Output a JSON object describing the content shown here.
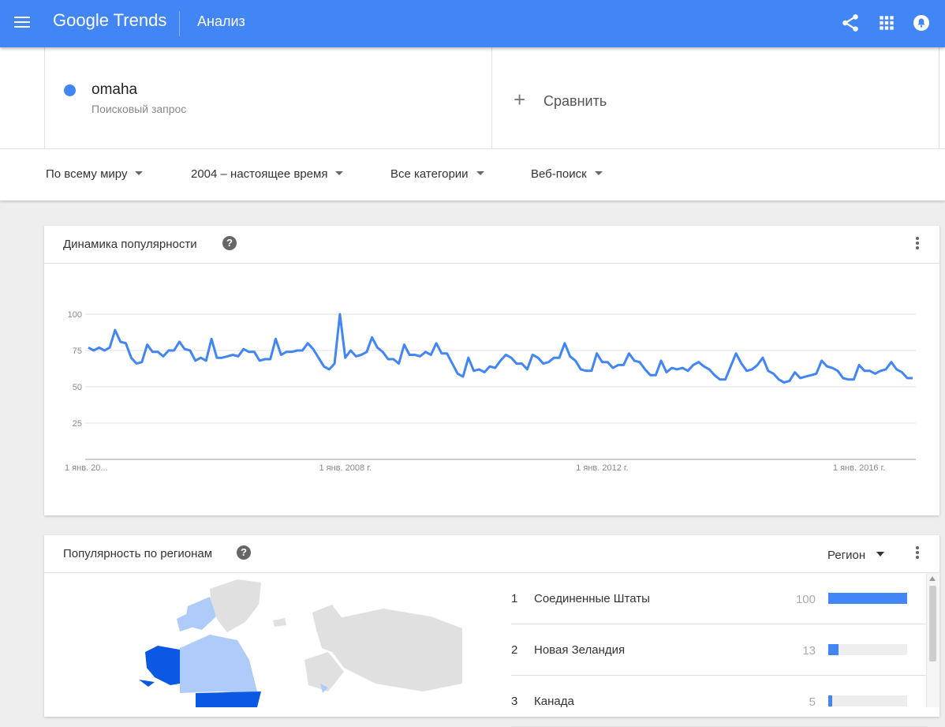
{
  "header": {
    "logo_google": "Google",
    "logo_trends": "Trends",
    "page_title": "Анализ",
    "bg_color": "#4285f4"
  },
  "search": {
    "term": "omaha",
    "term_type": "Поисковый запрос",
    "term_color": "#4285f4",
    "compare_label": "Сравнить"
  },
  "filters": {
    "location": "По всему миру",
    "time_range": "2004 – настоящее время",
    "category": "Все категории",
    "search_type": "Веб-поиск"
  },
  "interest_over_time": {
    "title": "Динамика популярности",
    "help": "?"
  },
  "chart_data": {
    "type": "line",
    "series": [
      {
        "name": "omaha",
        "start": "2004-01",
        "frequency": "monthly",
        "color": "#4285f4",
        "values": [
          77,
          75,
          77,
          75,
          77,
          89,
          81,
          80,
          70,
          66,
          67,
          79,
          74,
          74,
          71,
          75,
          75,
          81,
          76,
          75,
          68,
          70,
          68,
          83,
          70,
          70,
          71,
          72,
          71,
          76,
          74,
          74,
          68,
          69,
          69,
          83,
          72,
          74,
          74,
          75,
          75,
          80,
          76,
          70,
          64,
          62,
          66,
          100,
          70,
          75,
          71,
          72,
          74,
          84,
          77,
          74,
          69,
          69,
          66,
          79,
          72,
          72,
          71,
          74,
          72,
          80,
          73,
          73,
          66,
          59,
          57,
          70,
          61,
          62,
          60,
          64,
          63,
          68,
          72,
          70,
          66,
          66,
          62,
          72,
          70,
          66,
          67,
          70,
          70,
          80,
          71,
          68,
          62,
          61,
          61,
          73,
          67,
          67,
          63,
          65,
          65,
          73,
          68,
          67,
          62,
          58,
          58,
          68,
          60,
          63,
          62,
          63,
          61,
          65,
          67,
          64,
          62,
          58,
          55,
          55,
          64,
          73,
          66,
          61,
          62,
          65,
          70,
          61,
          59,
          55,
          53,
          54,
          60,
          56,
          57,
          58,
          59,
          68,
          64,
          63,
          61,
          56,
          55,
          55,
          65,
          61,
          61,
          59,
          61,
          62,
          67,
          62,
          60,
          56,
          56
        ]
      }
    ],
    "x_ticks": [
      "1 янв. 20...",
      "1 янв. 2008 г.",
      "1 янв. 2012 г.",
      "1 янв. 2016 г."
    ],
    "y_ticks": [
      100,
      75,
      50,
      25
    ],
    "ylim": [
      0,
      100
    ],
    "grid": true
  },
  "regions": {
    "title": "Популярность по регионам",
    "help": "?",
    "dropdown_label": "Регион",
    "map_colors": {
      "high": "#0b58e4",
      "medium": "#aecbfa",
      "none": "#e0e0e0"
    },
    "rows": [
      {
        "rank": "1",
        "name": "Соединенные Штаты",
        "value": 100
      },
      {
        "rank": "2",
        "name": "Новая Зеландия",
        "value": 13
      },
      {
        "rank": "3",
        "name": "Канада",
        "value": 5
      }
    ]
  }
}
